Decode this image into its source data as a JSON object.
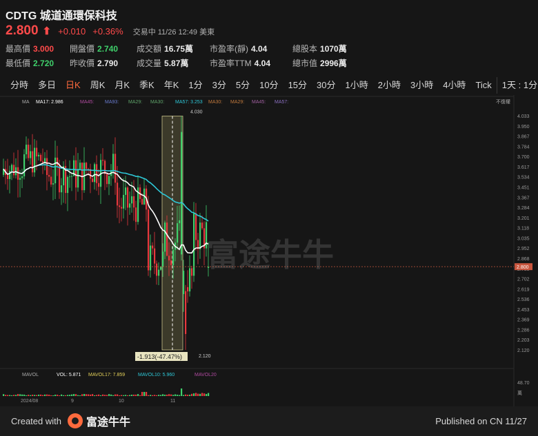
{
  "header": {
    "title": "CDTG 城道通環保科技",
    "price": "2.800",
    "change": "+0.010",
    "change_pct": "+0.36%",
    "status": "交易中  11/26 12:49 美東"
  },
  "stats": [
    {
      "label": "最高價",
      "value": "3.000",
      "tone": "red"
    },
    {
      "label": "開盤價",
      "value": "2.740",
      "tone": "green"
    },
    {
      "label": "成交額",
      "value": "16.75萬",
      "tone": ""
    },
    {
      "label": "市盈率(靜)",
      "value": "4.04",
      "tone": ""
    },
    {
      "label": "總股本",
      "value": "1070萬",
      "tone": ""
    },
    {
      "label": "最低價",
      "value": "2.720",
      "tone": "green"
    },
    {
      "label": "昨收價",
      "value": "2.790",
      "tone": ""
    },
    {
      "label": "成交量",
      "value": "5.87萬",
      "tone": ""
    },
    {
      "label": "市盈率TTM",
      "value": "4.04",
      "tone": ""
    },
    {
      "label": "總市值",
      "value": "2996萬",
      "tone": ""
    }
  ],
  "tabs": [
    "分時",
    "多日",
    "日K",
    "周K",
    "月K",
    "季K",
    "年K",
    "1分",
    "3分",
    "5分",
    "10分",
    "15分",
    "30分",
    "1小時",
    "2小時",
    "3小時",
    "4小時",
    "Tick",
    "1天 : 1分K"
  ],
  "active_tab": "日K",
  "legend": {
    "ma": "MA",
    "ma17": "MA17: 2.986",
    "ma45": "MA45:",
    "ma93": "MA93:",
    "ma29": "MA29:",
    "ma30": "MA30:",
    "ma57": "MA57: 3.253",
    "ma30b": "MA30:",
    "ma29b": "MA29:",
    "ma45b": "MA45:",
    "ma57b": "MA57:",
    "adjust": "不復權"
  },
  "vol_legend": {
    "mavol": "MAVOL",
    "vol": "VOL: 5.871",
    "mavol17": "MAVOL17: 7.859",
    "mavol10": "MAVOL10: 5.960",
    "mavol20": "MAVOL20",
    "max": "48.70",
    "unit": "萬"
  },
  "annotations": {
    "high": "4.030",
    "low": "2.120",
    "range": "-1.913(-47.47%)",
    "current": "2.800"
  },
  "watermark": "富途牛牛",
  "x_labels": [
    "2024/08",
    "9",
    "10",
    "11"
  ],
  "chart_data": {
    "type": "candlestick",
    "ylim": [
      2.12,
      4.033
    ],
    "y_ticks": [
      "4.033",
      "3.950",
      "3.867",
      "3.784",
      "3.700",
      "3.617",
      "3.534",
      "3.451",
      "3.367",
      "3.284",
      "3.201",
      "3.118",
      "3.035",
      "2.952",
      "2.868",
      "2.785",
      "2.702",
      "2.619",
      "2.536",
      "2.453",
      "2.369",
      "2.286",
      "2.203",
      "2.120"
    ],
    "x_labels": [
      "2024/08",
      "9",
      "10",
      "11"
    ],
    "ma17_end": 2.986,
    "ma57_end": 3.253,
    "current_price": 2.8,
    "period_high": 4.03,
    "period_low": 2.12,
    "colors": {
      "up": "#3fd06b",
      "down": "#e8383d",
      "ma17": "#ffffff",
      "ma57": "#2ec8d8"
    }
  },
  "footer": {
    "created": "Created with",
    "brand": "富途牛牛",
    "published": "Published on CN 11/27"
  }
}
